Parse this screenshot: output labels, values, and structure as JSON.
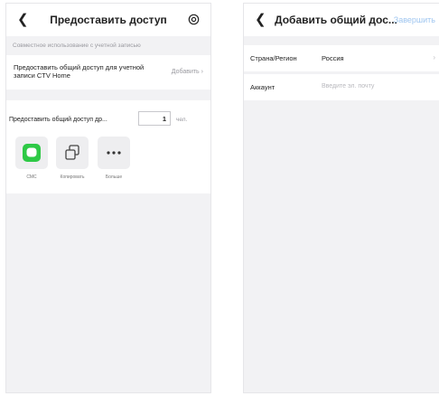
{
  "left_screen": {
    "back_icon": "back-arrow-icon",
    "title": "Предоставить доступ",
    "settings_icon": "gear-icon",
    "section_label": "Совместное использование с учетной записью",
    "ctv_share": {
      "label": "Предоставить общий доступ для учетной записи CTV Home",
      "action": "Добавить",
      "chevron": "›"
    },
    "share_count": {
      "label": "Предоставить общий доступ др...",
      "value": "1",
      "unit": "чел."
    },
    "share_options": [
      {
        "label": "СМС",
        "icon": "sms-icon",
        "color": "#2ec946"
      },
      {
        "label": "Копировать",
        "icon": "copy-icon"
      },
      {
        "label": "Больше",
        "icon": "more-icon"
      }
    ]
  },
  "right_screen": {
    "back_icon": "back-arrow-icon",
    "title": "Добавить общий дос...",
    "finish_label": "Завершить",
    "finish_color": "#9fc6f0",
    "country": {
      "label": "Страна/Регион",
      "value": "Россия",
      "chevron": "›"
    },
    "account": {
      "label": "Аккаунт",
      "placeholder": "Введите эл. почту"
    }
  }
}
